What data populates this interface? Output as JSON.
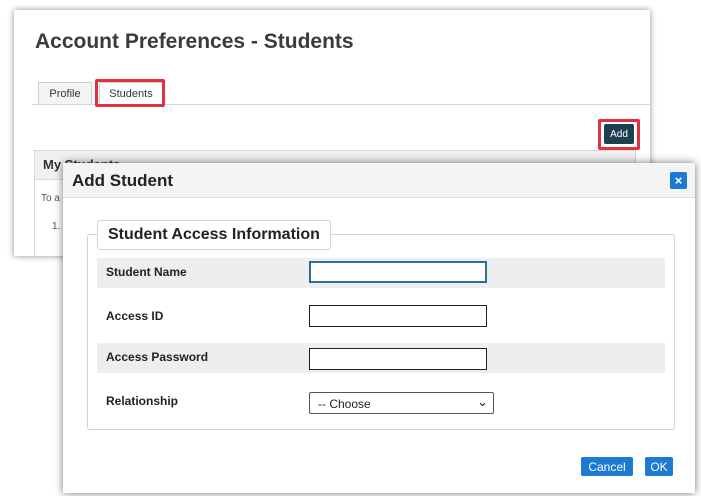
{
  "page": {
    "title": "Account Preferences - Students",
    "tabs": [
      {
        "label": "Profile"
      },
      {
        "label": "Students"
      }
    ],
    "add_label": "Add",
    "my_students_title": "My Students",
    "bg_text_1": "To a",
    "bg_text_2": "1."
  },
  "dialog": {
    "title": "Add Student",
    "close_label": "×",
    "legend": "Student Access Information",
    "fields": {
      "student_name": {
        "label": "Student Name",
        "value": ""
      },
      "access_id": {
        "label": "Access ID",
        "value": ""
      },
      "access_password": {
        "label": "Access Password",
        "value": ""
      },
      "relationship": {
        "label": "Relationship",
        "selected": "-- Choose"
      }
    },
    "cancel_label": "Cancel",
    "ok_label": "OK"
  },
  "colors": {
    "highlight": "#e0313f",
    "primary_button": "#1c7ad2",
    "add_button": "#1e3f4f"
  },
  "icons": {
    "close": "close-icon",
    "select_arrow": "chevron-down-icon"
  }
}
